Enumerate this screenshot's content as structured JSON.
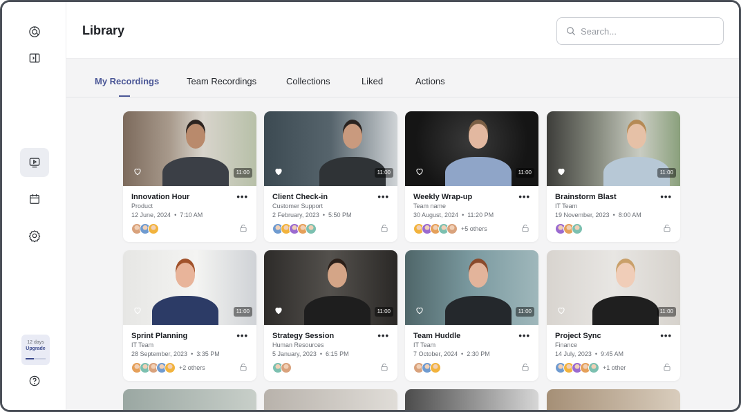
{
  "header": {
    "title": "Library"
  },
  "search": {
    "placeholder": "Search..."
  },
  "sidebar": {
    "icons": [
      "logo-icon",
      "sidebar-toggle-icon",
      "recordings-icon",
      "calendar-icon",
      "settings-icon",
      "help-icon"
    ],
    "trial": {
      "days_left": "12 days",
      "upgrade_label": "Upgrade",
      "progress": 0.4
    }
  },
  "tabs": [
    {
      "label": "My Recordings",
      "active": true
    },
    {
      "label": "Team Recordings",
      "active": false
    },
    {
      "label": "Collections",
      "active": false
    },
    {
      "label": "Liked",
      "active": false
    },
    {
      "label": "Actions",
      "active": false
    }
  ],
  "colors": {
    "accent": "#4a5696",
    "background": "#f4f4f5"
  },
  "recordings": [
    {
      "title": "Innovation Hour",
      "team": "Product",
      "date": "12 June, 2024",
      "time": "7:10 AM",
      "duration": "11:00",
      "liked": false,
      "participants": 3,
      "others": ""
    },
    {
      "title": "Client Check-in",
      "team": "Customer Support",
      "date": "2 February, 2023",
      "time": "5:50 PM",
      "duration": "11:00",
      "liked": true,
      "participants": 5,
      "others": ""
    },
    {
      "title": "Weekly Wrap-up",
      "team": "Team name",
      "date": "30 August, 2024",
      "time": "11:20 PM",
      "duration": "11:00",
      "liked": false,
      "participants": 5,
      "others": "+5 others"
    },
    {
      "title": "Brainstorm Blast",
      "team": "IT Team",
      "date": "19 November, 2023",
      "time": "8:00 AM",
      "duration": "11:00",
      "liked": true,
      "participants": 3,
      "others": ""
    },
    {
      "title": "Sprint Planning",
      "team": "IT Team",
      "date": "28 September, 2023",
      "time": "3:35 PM",
      "duration": "11:00",
      "liked": false,
      "participants": 5,
      "others": "+2 others"
    },
    {
      "title": "Strategy Session",
      "team": "Human Resources",
      "date": "5 January, 2023",
      "time": "6:15 PM",
      "duration": "11:00",
      "liked": true,
      "participants": 2,
      "others": ""
    },
    {
      "title": "Team Huddle",
      "team": "IT Team",
      "date": "7 October, 2024",
      "time": "2:30 PM",
      "duration": "11:00",
      "liked": false,
      "participants": 3,
      "others": ""
    },
    {
      "title": "Project Sync",
      "team": "Finance",
      "date": "14 July, 2023",
      "time": "9:45 AM",
      "duration": "11:00",
      "liked": false,
      "participants": 5,
      "others": "+1 other"
    }
  ]
}
